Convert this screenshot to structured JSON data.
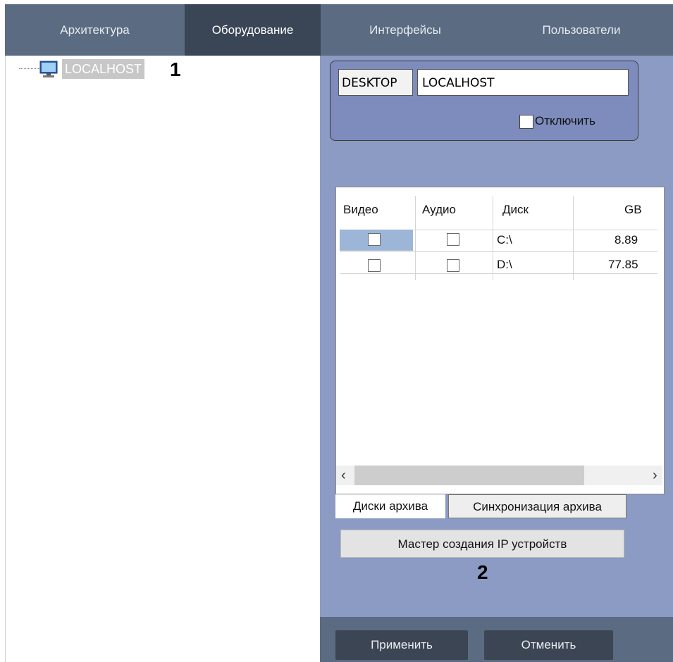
{
  "tabs": [
    {
      "label": "Архитектура",
      "active": false
    },
    {
      "label": "Оборудование",
      "active": true
    },
    {
      "label": "Интерфейсы",
      "active": false
    },
    {
      "label": "Пользователи",
      "active": false
    }
  ],
  "tree": {
    "host_label": "LOCALHOST",
    "icon": "computer-icon"
  },
  "annotations": {
    "marker1": "1",
    "marker2": "2"
  },
  "host_settings": {
    "desktop_name": "DESKTOP",
    "host_name": "LOCALHOST",
    "disable_label": "Отключить",
    "disable_checked": false
  },
  "disk_table": {
    "headers": [
      "Видео",
      "Аудио",
      "Диск",
      "GB"
    ],
    "rows": [
      {
        "video": false,
        "audio": false,
        "disk": "C:\\",
        "gb": "8.89",
        "selected": true
      },
      {
        "video": false,
        "audio": false,
        "disk": "D:\\",
        "gb": "77.85",
        "selected": false
      }
    ]
  },
  "bottom_tabs": [
    "Диски архива",
    "Синхронизация архива"
  ],
  "wizard_button": "Мастер создания IP устройств",
  "footer": {
    "apply": "Применить",
    "cancel": "Отменить"
  },
  "colors": {
    "tabbar": "#5b6b82",
    "tab_active": "#3a4556",
    "panel": "#8c9bc4",
    "row_highlight": "#9db5d6"
  }
}
